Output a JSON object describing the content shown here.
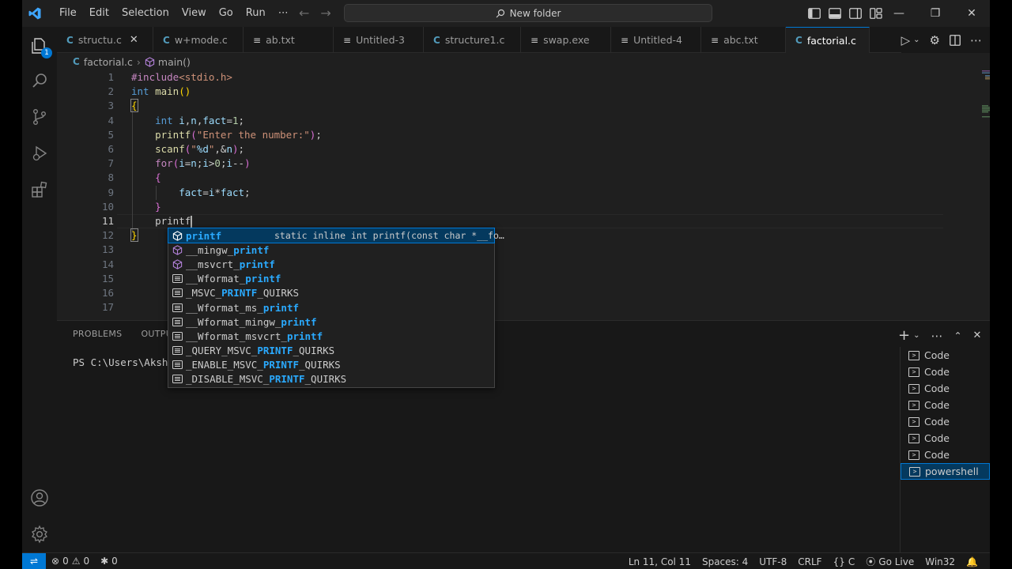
{
  "titlebar": {
    "menu": [
      "File",
      "Edit",
      "Selection",
      "View",
      "Go",
      "Run",
      "⋯"
    ],
    "search_text": "New folder"
  },
  "activity": {
    "explorer_badge": "1"
  },
  "tabs": [
    {
      "icon": "C",
      "label": "structu.c",
      "close": "✕",
      "active": false
    },
    {
      "icon": "C",
      "label": "w+mode.c",
      "active": false
    },
    {
      "icon": "txt",
      "label": "ab.txt",
      "active": false
    },
    {
      "icon": "txt",
      "label": "Untitled-3",
      "active": false
    },
    {
      "icon": "C",
      "label": "structure1.c",
      "active": false
    },
    {
      "icon": "txt",
      "label": "swap.exe",
      "active": false
    },
    {
      "icon": "txt",
      "label": "Untitled-4",
      "active": false
    },
    {
      "icon": "txt",
      "label": "abc.txt",
      "active": false
    },
    {
      "icon": "C",
      "label": "factorial.c",
      "active": true
    }
  ],
  "breadcrumb": {
    "file": "factorial.c",
    "symbol": "main()"
  },
  "editor": {
    "line_numbers": [
      "1",
      "2",
      "3",
      "4",
      "5",
      "6",
      "7",
      "8",
      "9",
      "10",
      "11",
      "12",
      "13",
      "14",
      "15",
      "16",
      "17"
    ],
    "current_line": "11",
    "typed": "printf"
  },
  "suggest": {
    "items": [
      {
        "pre": "",
        "match": "printf",
        "post": "",
        "kind": "method",
        "detail": "static inline int printf(const char *__fo…"
      },
      {
        "pre": "__mingw_",
        "match": "printf",
        "post": "",
        "kind": "method"
      },
      {
        "pre": "__msvcrt_",
        "match": "printf",
        "post": "",
        "kind": "method"
      },
      {
        "pre": "__Wformat_",
        "match": "printf",
        "post": "",
        "kind": "text"
      },
      {
        "pre": "_MSVC_",
        "match": "PRINTF",
        "post": "_QUIRKS",
        "kind": "text"
      },
      {
        "pre": "__Wformat_ms_",
        "match": "printf",
        "post": "",
        "kind": "text"
      },
      {
        "pre": "__Wformat_mingw_",
        "match": "printf",
        "post": "",
        "kind": "text"
      },
      {
        "pre": "__Wformat_msvcrt_",
        "match": "printf",
        "post": "",
        "kind": "text"
      },
      {
        "pre": "_QUERY_MSVC_",
        "match": "PRINTF",
        "post": "_QUIRKS",
        "kind": "text"
      },
      {
        "pre": "_ENABLE_MSVC_",
        "match": "PRINTF",
        "post": "_QUIRKS",
        "kind": "text"
      },
      {
        "pre": "_DISABLE_MSVC_",
        "match": "PRINTF",
        "post": "_QUIRKS",
        "kind": "text"
      }
    ]
  },
  "panel": {
    "tabs": [
      "PROBLEMS",
      "OUTPUT"
    ],
    "terminal_prompt": "PS C:\\Users\\Akshi",
    "terminals": [
      {
        "label": "Code",
        "selected": false
      },
      {
        "label": "Code",
        "selected": false
      },
      {
        "label": "Code",
        "selected": false
      },
      {
        "label": "Code",
        "selected": false
      },
      {
        "label": "Code",
        "selected": false
      },
      {
        "label": "Code",
        "selected": false
      },
      {
        "label": "Code",
        "selected": false
      },
      {
        "label": "powershell",
        "selected": true
      }
    ]
  },
  "status": {
    "errors": "0",
    "warnings": "0",
    "ports": "0",
    "position": "Ln 11, Col 11",
    "spaces": "Spaces: 4",
    "encoding": "UTF-8",
    "eol": "CRLF",
    "language": "C",
    "golive": "Go Live",
    "platform": "Win32"
  },
  "colors": {
    "accent": "#0078d4",
    "keyword": "#569cd6",
    "string": "#ce9178",
    "function": "#dcdcaa",
    "variable": "#9cdcfe",
    "match": "#2aaaff"
  }
}
